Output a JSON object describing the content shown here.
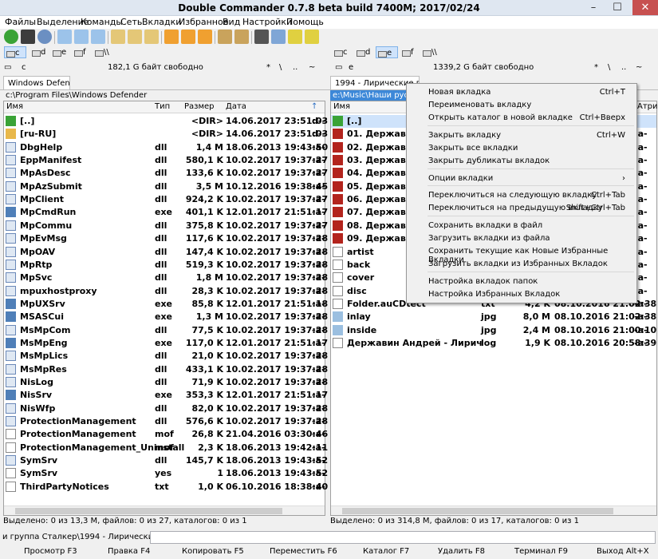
{
  "window": {
    "title": "Double Commander 0.7.8 beta build 7400M; 2017/02/24"
  },
  "menu": [
    "Файлы",
    "Выделение",
    "Команды",
    "Сеть",
    "Вкладки",
    "Избранное",
    "Вид",
    "Настройки",
    "Помощь"
  ],
  "left": {
    "drive": "c",
    "drives": [
      "c",
      "d",
      "e",
      "f",
      "\\\\"
    ],
    "free": "182,1 G байт свободно",
    "nav": [
      "*",
      "\\",
      "..",
      "~"
    ],
    "tab": "Windows Defender",
    "path": "c:\\Program Files\\Windows Defender",
    "columns": {
      "name": "Имя",
      "ext": "Тип",
      "size": "Размер",
      "date": "Дата"
    },
    "files": [
      {
        "name": "[..]",
        "ext": "",
        "size": "<DIR>",
        "date": "14.06.2017 23:51:03",
        "attr": "d-----"
      },
      {
        "name": "[ru-RU]",
        "ext": "",
        "size": "<DIR>",
        "date": "14.06.2017 23:51:03",
        "attr": "d-----"
      },
      {
        "name": "DbgHelp",
        "ext": "dll",
        "size": "1,4 M",
        "date": "18.06.2013 19:43:50",
        "attr": "-a----"
      },
      {
        "name": "EppManifest",
        "ext": "dll",
        "size": "580,1 K",
        "date": "10.02.2017 19:37:27",
        "attr": "-a----"
      },
      {
        "name": "MpAsDesc",
        "ext": "dll",
        "size": "133,6 K",
        "date": "10.02.2017 19:37:27",
        "attr": "-a----"
      },
      {
        "name": "MpAzSubmit",
        "ext": "dll",
        "size": "3,5 M",
        "date": "10.12.2016 19:38:45",
        "attr": "-a----"
      },
      {
        "name": "MpClient",
        "ext": "dll",
        "size": "924,2 K",
        "date": "10.02.2017 19:37:27",
        "attr": "-a----"
      },
      {
        "name": "MpCmdRun",
        "ext": "exe",
        "size": "401,1 K",
        "date": "12.01.2017 21:51:17",
        "attr": "-a----"
      },
      {
        "name": "MpCommu",
        "ext": "dll",
        "size": "375,8 K",
        "date": "10.02.2017 19:37:27",
        "attr": "-a----"
      },
      {
        "name": "MpEvMsg",
        "ext": "dll",
        "size": "117,6 K",
        "date": "10.02.2017 19:37:28",
        "attr": "-a----"
      },
      {
        "name": "MpOAV",
        "ext": "dll",
        "size": "147,4 K",
        "date": "10.02.2017 19:37:28",
        "attr": "-a----"
      },
      {
        "name": "MpRtp",
        "ext": "dll",
        "size": "519,3 K",
        "date": "10.02.2017 19:37:28",
        "attr": "-a----"
      },
      {
        "name": "MpSvc",
        "ext": "dll",
        "size": "1,8 M",
        "date": "10.02.2017 19:37:28",
        "attr": "-a----"
      },
      {
        "name": "mpuxhostproxy",
        "ext": "dll",
        "size": "28,3 K",
        "date": "10.02.2017 19:37:28",
        "attr": "-a----"
      },
      {
        "name": "MpUXSrv",
        "ext": "exe",
        "size": "85,8 K",
        "date": "12.01.2017 21:51:18",
        "attr": "-a----"
      },
      {
        "name": "MSASCui",
        "ext": "exe",
        "size": "1,3 M",
        "date": "10.02.2017 19:37:28",
        "attr": "-a----"
      },
      {
        "name": "MsMpCom",
        "ext": "dll",
        "size": "77,5 K",
        "date": "10.02.2017 19:37:28",
        "attr": "-a----"
      },
      {
        "name": "MsMpEng",
        "ext": "exe",
        "size": "117,0 K",
        "date": "12.01.2017 21:51:17",
        "attr": "-a----"
      },
      {
        "name": "MsMpLics",
        "ext": "dll",
        "size": "21,0 K",
        "date": "10.02.2017 19:37:28",
        "attr": "-a----"
      },
      {
        "name": "MsMpRes",
        "ext": "dll",
        "size": "433,1 K",
        "date": "10.02.2017 19:37:28",
        "attr": "-a----"
      },
      {
        "name": "NisLog",
        "ext": "dll",
        "size": "71,9 K",
        "date": "10.02.2017 19:37:28",
        "attr": "-a----"
      },
      {
        "name": "NisSrv",
        "ext": "exe",
        "size": "353,3 K",
        "date": "12.01.2017 21:51:17",
        "attr": "-a----"
      },
      {
        "name": "NisWfp",
        "ext": "dll",
        "size": "82,0 K",
        "date": "10.02.2017 19:37:28",
        "attr": "-a----"
      },
      {
        "name": "ProtectionManagement",
        "ext": "dll",
        "size": "576,6 K",
        "date": "10.02.2017 19:37:28",
        "attr": "-a----"
      },
      {
        "name": "ProtectionManagement",
        "ext": "mof",
        "size": "26,8 K",
        "date": "21.04.2016 03:30:46",
        "attr": "-a----"
      },
      {
        "name": "ProtectionManagement_Uninstall",
        "ext": "mof",
        "size": "2,3 K",
        "date": "18.06.2013 19:42:11",
        "attr": "-a----"
      },
      {
        "name": "SymSrv",
        "ext": "dll",
        "size": "145,7 K",
        "date": "18.06.2013 19:43:52",
        "attr": "-a----"
      },
      {
        "name": "SymSrv",
        "ext": "yes",
        "size": "1",
        "date": "18.06.2013 19:43:52",
        "attr": "-a----"
      },
      {
        "name": "ThirdPartyNotices",
        "ext": "txt",
        "size": "1,0 K",
        "date": "06.10.2016 18:38:40",
        "attr": "-a----"
      }
    ],
    "status": "Выделено: 0 из 13,3 M, файлов: 0 из 27, каталогов: 0 из 1"
  },
  "right": {
    "drive": "e",
    "drives": [
      "c",
      "d",
      "e",
      "f",
      "\\\\"
    ],
    "free": "1339,2 G байт свободно",
    "nav": [
      "*",
      "\\",
      "..",
      "~"
    ],
    "tab": "1994 - Лирические песни",
    "path": "e:\\Music\\Наши русски",
    "columns": {
      "name": "Имя",
      "attr": "Атри"
    },
    "files": [
      {
        "name": "[..]",
        "ext": "",
        "size": "",
        "date": "",
        "attr": ""
      },
      {
        "name": "01. Державин А",
        "ext": "",
        "size": "",
        "date": "",
        "attr": "-a-"
      },
      {
        "name": "02. Державин А",
        "ext": "",
        "size": "",
        "date": "",
        "attr": "-a-"
      },
      {
        "name": "03. Державин А",
        "ext": "",
        "size": "",
        "date": "",
        "attr": "-a-"
      },
      {
        "name": "04. Державин А",
        "ext": "",
        "size": "",
        "date": "",
        "attr": "-a-"
      },
      {
        "name": "05. Державин А",
        "ext": "",
        "size": "",
        "date": "",
        "attr": "-a-"
      },
      {
        "name": "06. Державин А",
        "ext": "",
        "size": "",
        "date": "",
        "attr": "-a-"
      },
      {
        "name": "07. Державин А",
        "ext": "",
        "size": "",
        "date": "",
        "attr": "-a-"
      },
      {
        "name": "08. Державин А",
        "ext": "",
        "size": "",
        "date": "",
        "attr": "-a-"
      },
      {
        "name": "09. Державин А",
        "ext": "",
        "size": "",
        "date": "",
        "attr": "-a-"
      },
      {
        "name": "artist",
        "ext": "",
        "size": "",
        "date": "",
        "attr": "-a-"
      },
      {
        "name": "back",
        "ext": "",
        "size": "",
        "date": "",
        "attr": "-a-"
      },
      {
        "name": "cover",
        "ext": "",
        "size": "",
        "date": "",
        "attr": "-a-"
      },
      {
        "name": "disc",
        "ext": "",
        "size": "",
        "date": "",
        "attr": "-a-"
      },
      {
        "name": "Folder.auCDtect",
        "ext": "txt",
        "size": "4,2 K",
        "date": "08.10.2016 21:02:38",
        "attr": "-a-"
      },
      {
        "name": "inlay",
        "ext": "jpg",
        "size": "8,0 M",
        "date": "08.10.2016 21:02:38",
        "attr": "-a-"
      },
      {
        "name": "inside",
        "ext": "jpg",
        "size": "2,4 M",
        "date": "08.10.2016 21:00:10",
        "attr": "-a-"
      },
      {
        "name": "Державин Андрей - Лирически...",
        "ext": "log",
        "size": "1,9 K",
        "date": "08.10.2016 20:58:39",
        "attr": "-a-"
      }
    ],
    "status": "Выделено: 0 из 314,8 M, файлов: 0 из 17, каталогов: 0 из 1"
  },
  "context_menu": [
    {
      "label": "Новая вкладка",
      "shortcut": "Ctrl+T"
    },
    {
      "label": "Переименовать вкладку",
      "shortcut": ""
    },
    {
      "label": "Открыть каталог в новой вкладке",
      "shortcut": "Ctrl+Вверх"
    },
    {
      "label": "Закрыть вкладку",
      "shortcut": "Ctrl+W"
    },
    {
      "label": "Закрыть все вкладки",
      "shortcut": ""
    },
    {
      "label": "Закрыть дубликаты вкладок",
      "shortcut": ""
    },
    {
      "label": "Опции вкладки",
      "shortcut": "›"
    },
    {
      "label": "Переключиться на следующую вкладку",
      "shortcut": "Ctrl+Tab"
    },
    {
      "label": "Переключиться на предыдущую вкладку",
      "shortcut": "Shift+Ctrl+Tab"
    },
    {
      "label": "Сохранить вкладки в файл",
      "shortcut": ""
    },
    {
      "label": "Загрузить вкладки из файла",
      "shortcut": ""
    },
    {
      "label": "Сохранить текущие как Новые Избранные Вкладки",
      "shortcut": ""
    },
    {
      "label": "Загрузить вкладки из Избранных Вкладок",
      "shortcut": ""
    },
    {
      "label": "Настройка вкладок папок",
      "shortcut": ""
    },
    {
      "label": "Настройка Избранных Вкладок",
      "shortcut": ""
    }
  ],
  "cmdline": {
    "prompt": "и группа Сталкер\\1994 - Лирические песни>"
  },
  "fkeys": [
    "Просмотр F3",
    "Правка F4",
    "Копировать F5",
    "Переместить F6",
    "Каталог F7",
    "Удалить F8",
    "Терминал F9",
    "Выход Alt+X"
  ],
  "colors": {
    "selection": "#cfe3fb",
    "menubg": "#f0f0f0",
    "updir": "#3aa336",
    "folder": "#e8b84a",
    "pdf": "#b3241d"
  }
}
